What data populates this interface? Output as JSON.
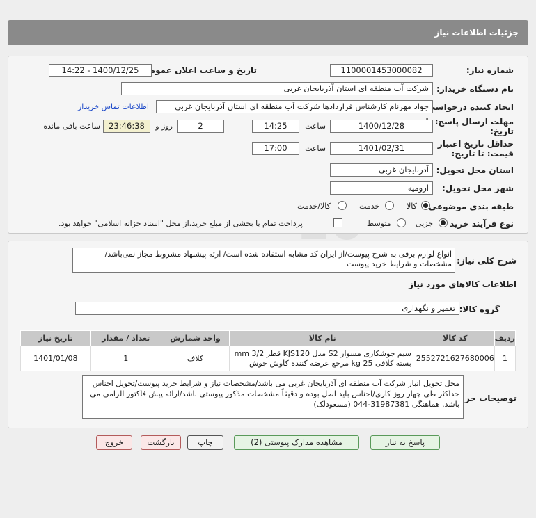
{
  "header": {
    "title": "جزئیات اطلاعات نیاز"
  },
  "fields": {
    "need_number_label": "شماره نیاز:",
    "need_number": "1100001453000082",
    "announce_label": "تاریخ و ساعت اعلان عمومی:",
    "announce_value": "1400/12/25 - 14:22",
    "buyer_org_label": "نام دستگاه خریدار:",
    "buyer_org": "شرکت آب منطقه ای استان آذربایجان غربی",
    "creator_label": "ایجاد کننده درخواست:",
    "creator": "جواد مهرنام کارشناس قراردادها شرکت آب منطقه ای استان آذربایجان غربی",
    "contact_link": "اطلاعات تماس خریدار",
    "deadline_label_1": "مهلت ارسال پاسخ: تا",
    "deadline_label_2": "تاریخ:",
    "deadline_date": "1400/12/28",
    "time_label": "ساعت",
    "deadline_time": "14:25",
    "days_value": "2",
    "days_label": "روز و",
    "remaining_time": "23:46:38",
    "remaining_label": "ساعت باقی مانده",
    "validity_label_1": "حداقل تاریخ اعتبار",
    "validity_label_2": "قیمت: تا تاریخ:",
    "validity_date": "1401/02/31",
    "validity_time_label": "ساعت",
    "validity_time": "17:00",
    "province_label": "استان محل تحویل:",
    "province": "آذربایجان غربی",
    "city_label": "شهر محل تحویل:",
    "city": "ارومیه",
    "category_label": "طبقه بندی موضوعی:",
    "category_options": [
      "کالا",
      "خدمت",
      "کالا/خدمت"
    ],
    "process_label": "نوع فرآیند خرید :",
    "process_options": [
      "جزیی",
      "متوسط"
    ],
    "payment_note": "پرداخت تمام یا بخشی از مبلغ خرید،از محل \"اسناد خزانه اسلامی\" خواهد بود."
  },
  "description": {
    "label": "شرح کلی نیاز:",
    "text": "انواع لوازم برقی به شرح پیوست/از ایران کد مشابه استفاده شده است/ ارئه پیشنهاد مشروط مجاز نمی‌باشد/مشخصات و شرایط خرید پیوست"
  },
  "goods": {
    "section_title": "اطلاعات کالاهای مورد نیاز",
    "group_label": "گروه کالا:",
    "group_value": "تعمیر و نگهداری",
    "columns": [
      "ردیف",
      "کد کالا",
      "نام کالا",
      "واحد شمارش",
      "تعداد / مقدار",
      "تاریخ نیاز"
    ],
    "rows": [
      {
        "row": "1",
        "code": "2552721627680006",
        "name": "سیم جوشکاری مسوار S2 مدل KJS120 قطر mm 3/2 بسته کلافی kg 25 مرجع عرضه کننده کاوش جوش",
        "unit": "کلاف",
        "qty": "1",
        "date": "1401/01/08"
      }
    ]
  },
  "buyer_notes": {
    "label": "توضیحات خریدار:",
    "text": "محل تحویل انبار شرکت آب منطقه ای آذربایجان غربی می باشد/مشخصات نیاز و شرایط خرید پیوست/تحویل اجناس حداکثر طی چهار روز کاری/اجناس باید اصل بوده و دقیقاً مشخصات مذکور پیوستی باشد/ارائه پیش فاکتور الزامی می باشد. هماهنگی 31987381-044 (مسعودلک)"
  },
  "buttons": {
    "reply": "پاسخ به نیاز",
    "view_docs": "مشاهده مدارک پیوستی (2)",
    "print": "چاپ",
    "back": "بازگشت",
    "exit": "خروج"
  }
}
